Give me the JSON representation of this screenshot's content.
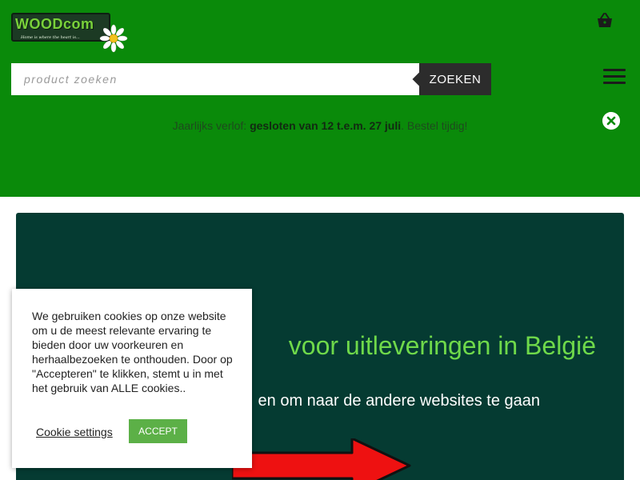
{
  "brand": {
    "logo_text": "WOODcom",
    "tagline": "Home is where the heart is..."
  },
  "icons": {
    "cart": "shopping-basket-icon",
    "menu": "hamburger-menu-icon",
    "close": "close-circle-icon",
    "daisy": "daisy-flower-icon",
    "arrow": "red-arrow-right-icon"
  },
  "search": {
    "placeholder": "product zoeken",
    "button_label": "ZOEKEN"
  },
  "notice": {
    "prefix": "Jaarlijks verlof: ",
    "highlight": "gesloten van 12 t.e.m. 27 juli",
    "suffix": ". Bestel tijdig!"
  },
  "banner": {
    "title": "voor uitleveringen in België",
    "subtitle": "en om naar de andere websites te gaan"
  },
  "cookie": {
    "message": "We gebruiken cookies op onze website om u de meest relevante ervaring te bieden door uw voorkeuren en herhaalbezoeken te onthouden. Door op \"Accepteren\" te klikken, stemt u in met het gebruik van ALLE cookies..",
    "settings_label": "Cookie settings",
    "accept_label": "ACCEPT"
  },
  "colors": {
    "header_bg": "#0a8a0a",
    "banner_bg": "#053b32",
    "accent_green": "#6fd94a",
    "accept_green": "#5cb047",
    "search_button": "#2c2c2c"
  }
}
